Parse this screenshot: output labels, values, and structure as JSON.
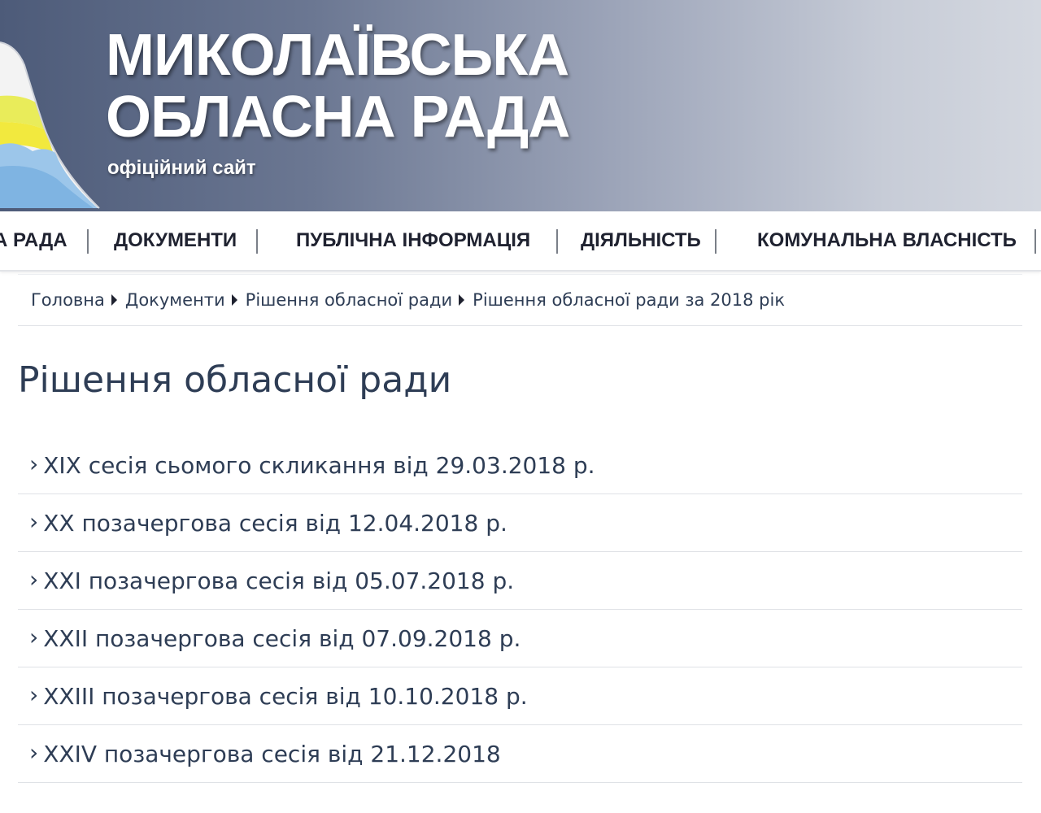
{
  "header": {
    "title_line1": "МИКОЛАЇВСЬКА",
    "title_line2": "ОБЛАСНА РАДА",
    "subtitle": "офіційний сайт",
    "logo_icon": "oblast-emblem-icon",
    "colors": {
      "gradient_start": "#4d5b79",
      "gradient_end": "#d4d8e0",
      "text": "#ffffff"
    }
  },
  "nav": {
    "items": [
      {
        "label": "А РАДА"
      },
      {
        "label": "ДОКУМЕНТИ"
      },
      {
        "label": "ПУБЛІЧНА ІНФОРМАЦІЯ"
      },
      {
        "label": "ДІЯЛЬНІСТЬ"
      },
      {
        "label": "КОМУНАЛЬНА ВЛАСНІСТЬ"
      }
    ]
  },
  "breadcrumb": {
    "items": [
      {
        "label": "Головна"
      },
      {
        "label": "Документи"
      },
      {
        "label": "Рішення обласної ради"
      }
    ],
    "current": "Рішення обласної ради за 2018 рік"
  },
  "page": {
    "title": "Рішення обласної ради"
  },
  "sessions": [
    {
      "label": "XIX сесія сьомого скликання від 29.03.2018 р."
    },
    {
      "label": "XX позачергова сесія від 12.04.2018 р."
    },
    {
      "label": "XXI позачергова сесія від 05.07.2018 р."
    },
    {
      "label": "XXII позачергова сесія від 07.09.2018 р."
    },
    {
      "label": "XXIII позачергова сесія від 10.10.2018 р."
    },
    {
      "label": "XXIV позачергова сесія від 21.12.2018"
    }
  ],
  "list_marker": "›",
  "colors": {
    "text": "#2e3d55",
    "nav_text": "#1f2230",
    "divider": "#dfe2e6"
  }
}
